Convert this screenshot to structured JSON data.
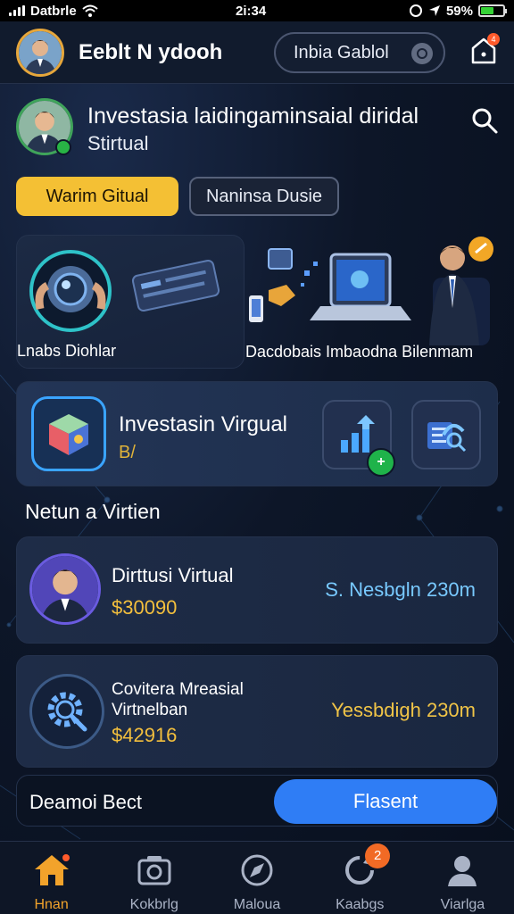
{
  "status_bar": {
    "carrier": "Datbrle",
    "time": "2i:34",
    "battery": "59%",
    "battery_level": 0.59
  },
  "header": {
    "title": "Eeblt N ydooh",
    "pill_label": "Inbia Gablol",
    "notification_count": "4"
  },
  "profile": {
    "heading": "Investasia laidingaminsaial diridal",
    "subtitle": "Stirtual"
  },
  "chips": {
    "primary": "Warim Gitual",
    "secondary": "Naninsa Dusie"
  },
  "features": [
    {
      "label": "Lnabs Diohlar",
      "icon": "camera-lens-icon"
    },
    {
      "label": "Dacdobais Imbaodna Bilenmam",
      "icon": "laptop-icon"
    }
  ],
  "invest_card": {
    "title": "Investasin Virgual",
    "subtitle": "B/",
    "icons": [
      "growth-chart-icon",
      "analytics-icon"
    ],
    "badge_icon": "plus-icon"
  },
  "section_title": "Netun a Virtien",
  "list": [
    {
      "name": "Dirttusi Virtual",
      "amount": "$30090",
      "right_text": "S. Nesbgln 230m"
    },
    {
      "name": "Covitera Mreasial Virtnelban",
      "amount": "$42916",
      "right_text": "Yessbdigh 230m"
    }
  ],
  "action": {
    "label": "Deamoi Bect",
    "button": "Flasent"
  },
  "tabs": [
    {
      "label": "Hnan",
      "icon": "home-icon",
      "active": true
    },
    {
      "label": "Kokbrlg",
      "icon": "camera-icon",
      "active": false
    },
    {
      "label": "Maloua",
      "icon": "compass-icon",
      "active": false
    },
    {
      "label": "Kaabgs",
      "icon": "refresh-icon",
      "active": false,
      "badge": "2"
    },
    {
      "label": "Viarlga",
      "icon": "user-icon",
      "active": false
    }
  ],
  "colors": {
    "accent_yellow": "#f4c034",
    "primary_blue": "#2f7df5",
    "bg": "#0d1628",
    "gold_text": "#f3bf3d",
    "cyan_text": "#78c9ff"
  }
}
